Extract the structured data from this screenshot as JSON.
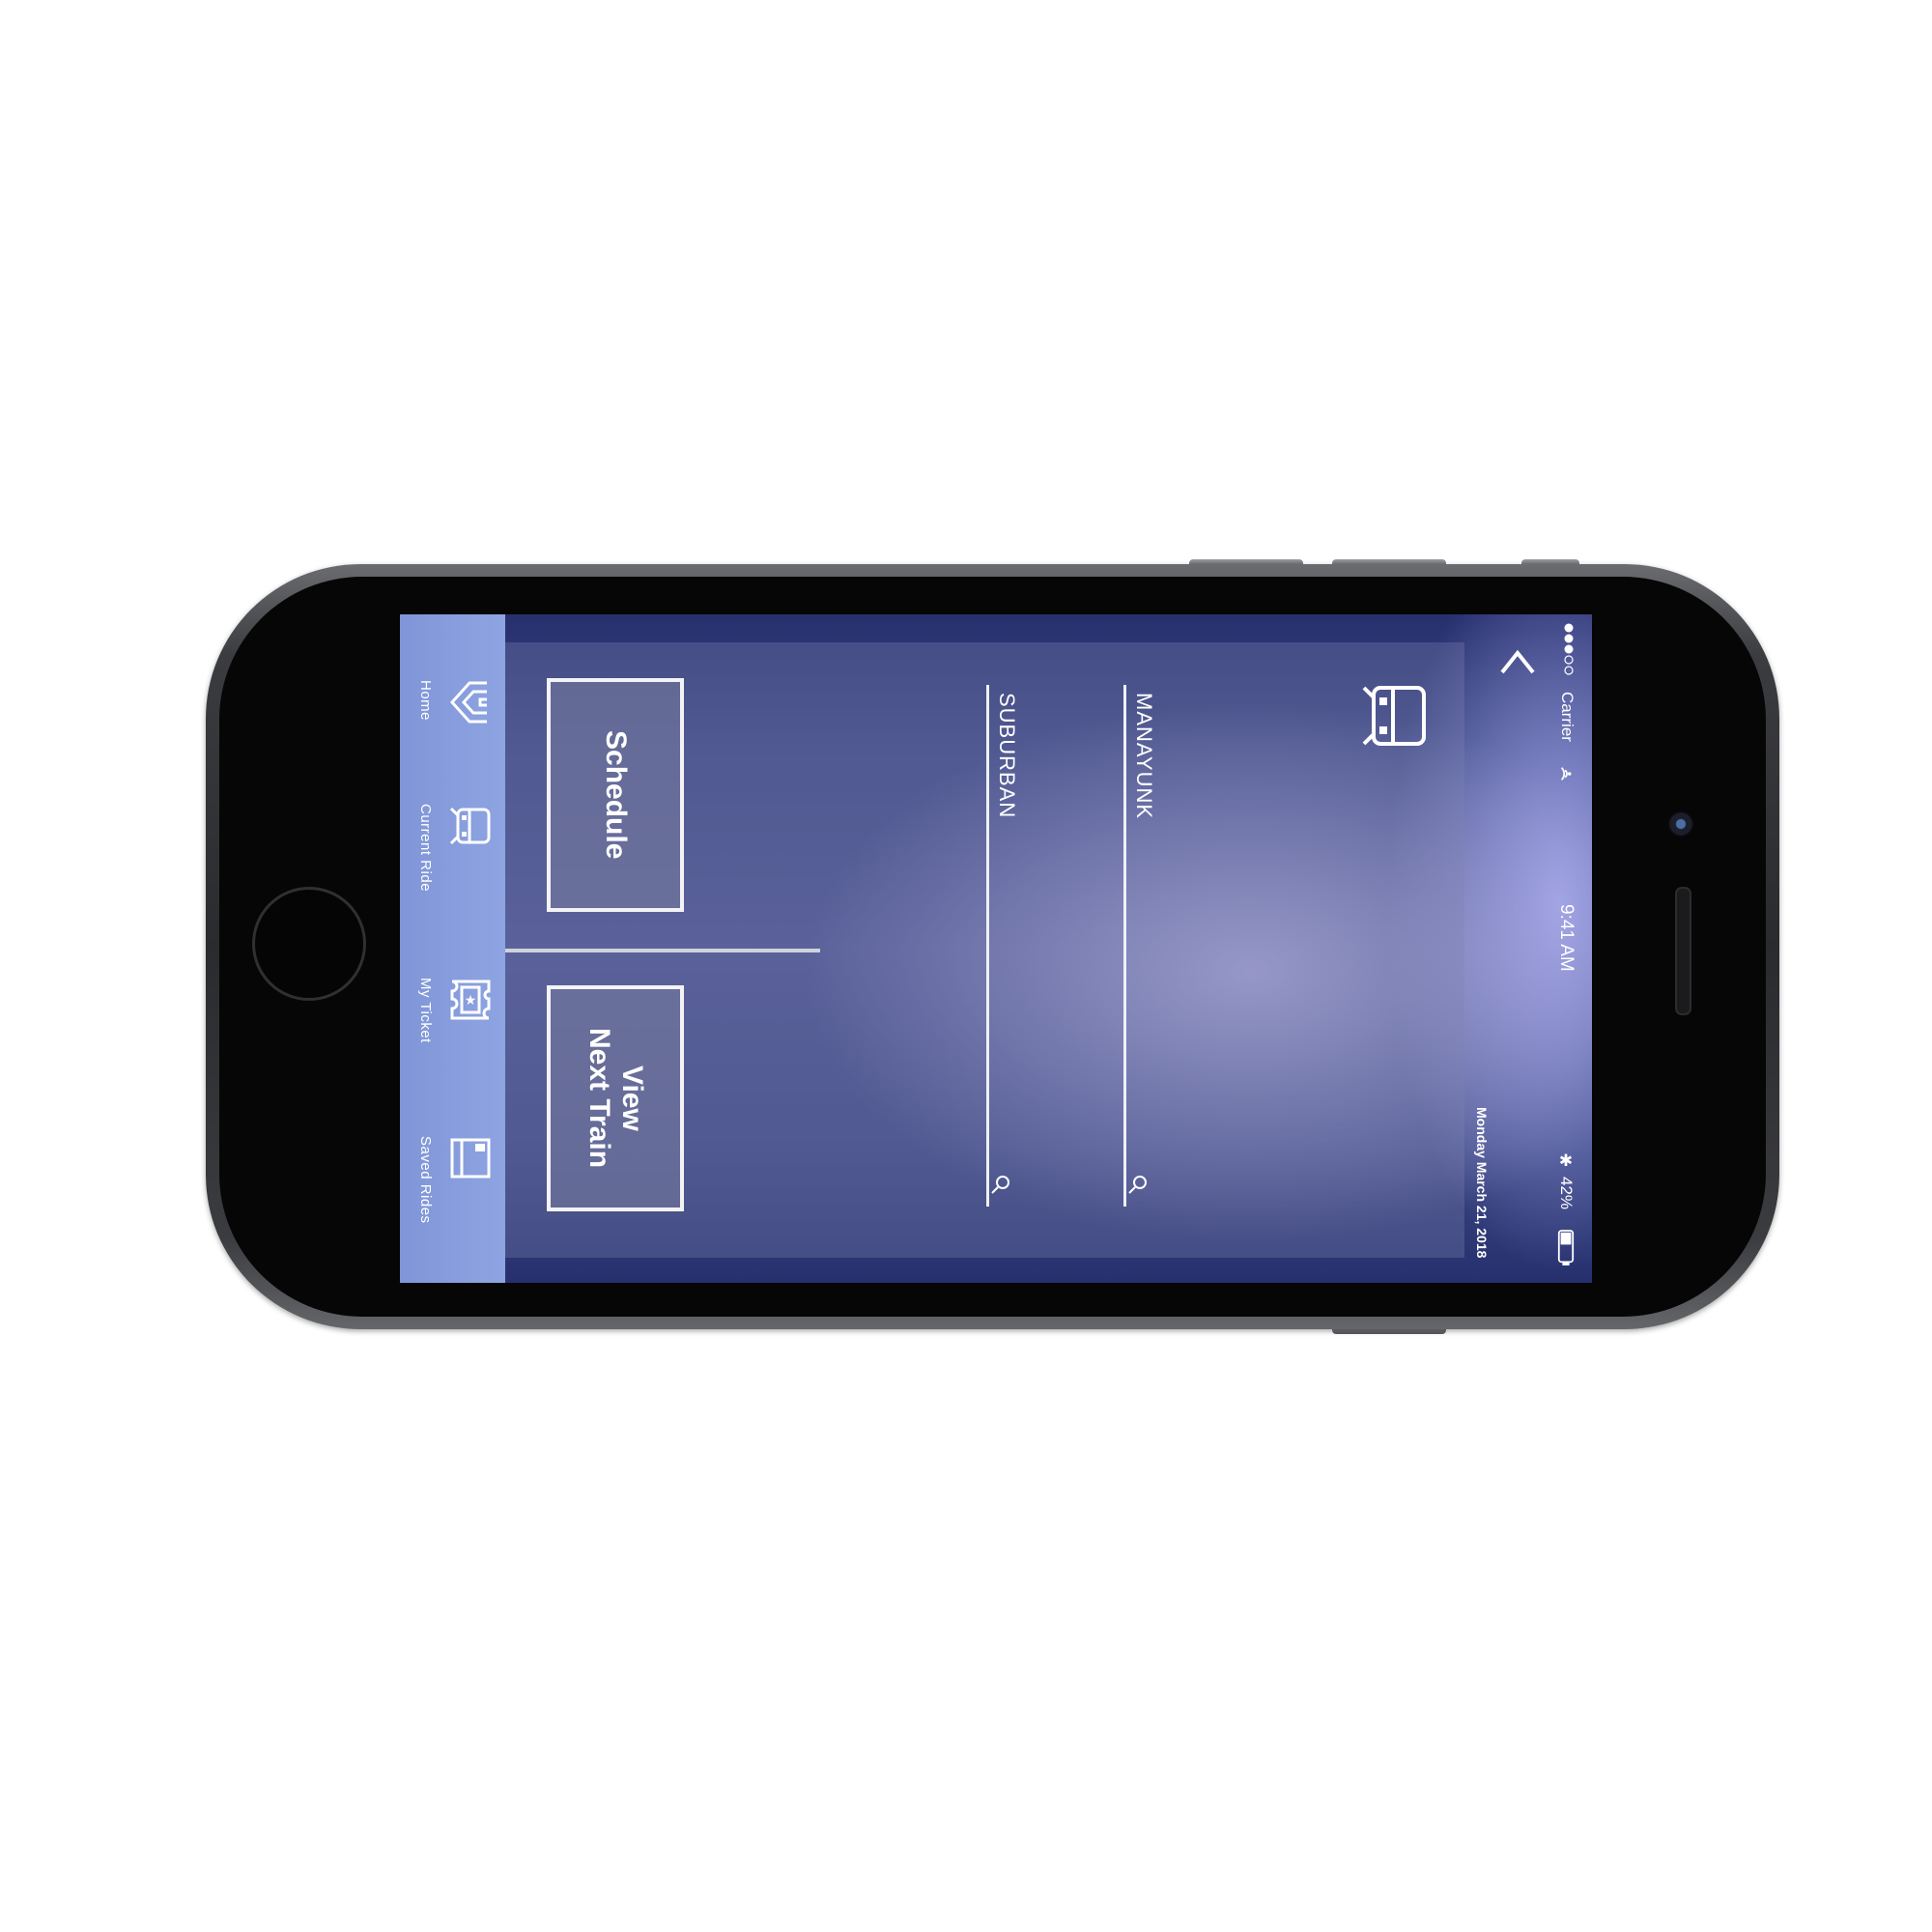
{
  "status_bar": {
    "carrier": "Carrier",
    "time": "9:41 AM",
    "battery": "42%",
    "signal_icon": "signal-dots-icon",
    "wifi_icon": "wifi-icon",
    "bluetooth_icon": "bluetooth-icon",
    "battery_icon": "battery-icon"
  },
  "header": {
    "date": "Monday March 21, 2018",
    "back_icon": "chevron-up-icon",
    "mode_icon": "train-icon"
  },
  "form": {
    "from_station": "MANAYUNK",
    "to_station": "SUBURBAN",
    "search_icon": "search-icon"
  },
  "actions": {
    "view_next_train": "View\nNext Train",
    "schedule": "Schedule"
  },
  "nav": {
    "items": [
      {
        "label": "Home",
        "icon": "home-icon"
      },
      {
        "label": "Current Ride",
        "icon": "train-icon"
      },
      {
        "label": "My Ticket",
        "icon": "ticket-icon"
      },
      {
        "label": "Saved Rides",
        "icon": "bookmark-icon"
      }
    ]
  },
  "colors": {
    "sidebar": "#8ea4e2",
    "background": "#3a4682",
    "accent": "#ffffff"
  }
}
